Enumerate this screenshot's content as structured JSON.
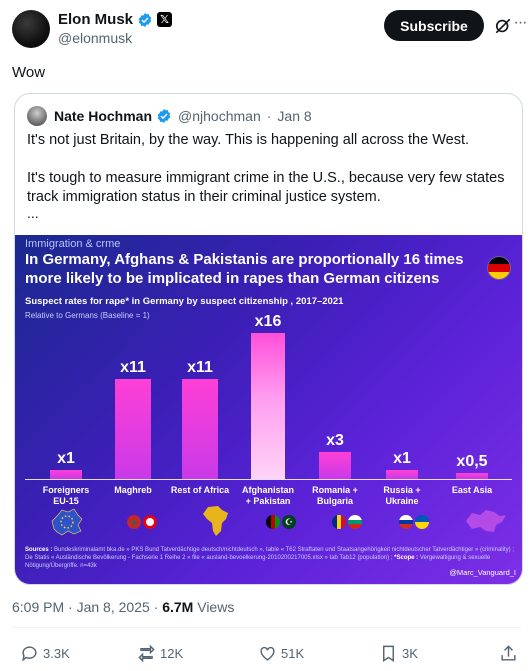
{
  "author": {
    "name": "Elon Musk",
    "handle": "@elonmusk",
    "subscribe_label": "Subscribe"
  },
  "tweet_text": "Wow",
  "quote": {
    "name": "Nate Hochman",
    "handle": "@njhochman",
    "date": "Jan 8",
    "separator": "·",
    "paragraph1": "It's not just Britain, by the way. This is happening all across the West.",
    "paragraph2": "It's tough to measure immigrant crime in the U.S., because very few states track immigration status in their criminal justice system.",
    "ellipsis": "..."
  },
  "infographic": {
    "kicker": "Immigration & crme",
    "title": "In Germany, Afghans & Pakistanis are proportionally 16 times more likely to be implicated in rapes than German citizens",
    "subtitle": "Suspect rates for rape* in Germany by suspect citizenship , 2017–2021",
    "baseline_note": "Relative to Germans (Baseline = 1)",
    "footer_sources_label": "Sources :",
    "footer_sources": "Bundeskriminalamt bka.de » PKS Bund Tatverdächtige deutsch/nichtdeutsch », table « T62 Straftaten und Staatsangehörigkeit nichtdeutscher Tatverdächtiger » (criminality) ; De Statis « Ausländische Bevölkerung - Fachserie 1 Reihe 2 » file « ausland-bevoelkerung-2010200217005.xlsx » tab Tab12 (population) ;",
    "footer_scope_label": "*Scope :",
    "footer_scope": "Vergewaltigung & sexuelle Nötigung/Übergriffe. n=43k",
    "credit": "@Marc_Vanguard_I",
    "flag_colors": [
      "#000000",
      "#dd0000",
      "#ffce00"
    ]
  },
  "chart_data": {
    "type": "bar",
    "title": "In Germany, Afghans & Pakistanis are proportionally 16 times more likely to be implicated in rapes than German citizens",
    "subtitle": "Suspect rates for rape* in Germany by suspect citizenship , 2017–2021",
    "ylabel": "Relative to Germans (Baseline = 1)",
    "categories": [
      "Foreigners EU-15",
      "Maghreb",
      "Rest of Africa",
      "Afghanistan + Pakistan",
      "Romania + Bulgaria",
      "Russia + Ukraine",
      "East Asia"
    ],
    "category_lines": [
      [
        "Foreigners",
        "EU-15"
      ],
      [
        "Maghreb"
      ],
      [
        "Rest of Africa"
      ],
      [
        "Afghanistan",
        "+ Pakistan"
      ],
      [
        "Romania +",
        "Bulgaria"
      ],
      [
        "Russia +",
        "Ukraine"
      ],
      [
        "East Asia"
      ]
    ],
    "values": [
      1,
      11,
      11,
      16,
      3,
      1,
      0.5
    ],
    "value_labels": [
      "x1",
      "x11",
      "x11",
      "x16",
      "x3",
      "x1",
      "x0,5"
    ],
    "highlight_index": 3,
    "ylim": [
      0,
      16
    ],
    "bar_color": "#d23be6",
    "highlight_color": "#ff6fe0"
  },
  "meta": {
    "time": "6:09 PM",
    "separator": "·",
    "date": "Jan 8, 2025",
    "views_count": "6.7M",
    "views_label": "Views"
  },
  "actions": {
    "replies": "3.3K",
    "reposts": "12K",
    "likes": "51K",
    "bookmarks": "3K"
  },
  "colors": {
    "verified": "#1d9bf0",
    "text_secondary": "#536471",
    "infographic_bg": "#3a1fb5"
  }
}
